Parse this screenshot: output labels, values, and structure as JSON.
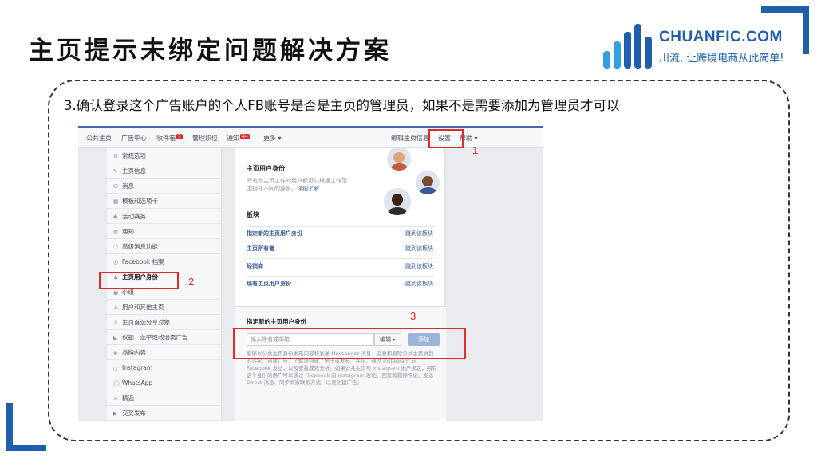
{
  "slide": {
    "title": "主页提示未绑定问题解决方案",
    "instruction": "3.确认登录这个广告账户的个人FB账号是否是主页的管理员，如果不是需要添加为管理员才可以"
  },
  "logo": {
    "name": "CHUANFIC.COM",
    "slogan": "川流, 让跨境电商从此简单!",
    "brand_color": "#1f5fae",
    "accent_color": "#2fa0e0"
  },
  "fb_nav": {
    "items": [
      "公共主页",
      "广告中心",
      "收件箱",
      "管理职位",
      "通知",
      "更多 ▾"
    ],
    "inbox_badge": "7",
    "notify_badge": "44",
    "right_items": [
      "编辑主页信息",
      "设置",
      "帮助 ▾"
    ]
  },
  "sidebar": {
    "items": [
      {
        "icon": "gear-icon",
        "glyph": "⚙",
        "label": "常规选项"
      },
      {
        "icon": "pencil-icon",
        "glyph": "✎",
        "label": "主页信息"
      },
      {
        "icon": "message-icon",
        "glyph": "✉",
        "label": "消息"
      },
      {
        "icon": "grid-icon",
        "glyph": "▦",
        "label": "模板和选项卡"
      },
      {
        "icon": "tag-icon",
        "glyph": "◆",
        "label": "活动赛务"
      },
      {
        "icon": "globe-icon",
        "glyph": "◍",
        "label": "通知"
      },
      {
        "icon": "chat-icon",
        "glyph": "◌",
        "label": "高级消息功能"
      },
      {
        "icon": "facebook-icon",
        "glyph": "◎",
        "label": "Facebook 档案"
      },
      {
        "icon": "person-icon",
        "glyph": "♟",
        "label": "主页用户身份"
      },
      {
        "icon": "group-icon",
        "glyph": "◒",
        "label": "小组"
      },
      {
        "icon": "people-icon",
        "glyph": "♙",
        "label": "用户和其他主页"
      },
      {
        "icon": "share-icon",
        "glyph": "♙",
        "label": "主页首选分享对象"
      },
      {
        "icon": "megaphone-icon",
        "glyph": "◣",
        "label": "议题、选举或政治类广告"
      },
      {
        "icon": "branded-content-icon",
        "glyph": "◈",
        "label": "品牌内容"
      },
      {
        "icon": "instagram-icon",
        "glyph": "◻",
        "label": "Instagram"
      },
      {
        "icon": "whatsapp-icon",
        "glyph": "◯",
        "label": "WhatsApp"
      },
      {
        "icon": "star-icon",
        "glyph": "★",
        "label": "精选"
      },
      {
        "icon": "video-icon",
        "glyph": "▶",
        "label": "交叉发布"
      }
    ]
  },
  "main": {
    "roles_title": "主页用户身份",
    "roles_desc": "所有为主页工作的用户都可以根据工作范围担任不同的身份。",
    "roles_link": "详细了解",
    "section_label": "板块",
    "rows": [
      {
        "label": "指定新的主页用户身份",
        "link": "跳到该板块"
      },
      {
        "label": "主页所有者",
        "link": "跳到该板块"
      },
      {
        "label": "经销商",
        "link": "跳到该板块"
      },
      {
        "label": "现有主页用户身份",
        "link": "跳到该板块"
      }
    ],
    "assign_title": "指定新的主页用户身份",
    "input_placeholder": "输入姓名或邮箱",
    "edit_label": "编辑 ▸",
    "add_label": "添加",
    "assign_desc": "能够以公共主页身份发布内容和发送 Messenger 消息、回复和删除公共主页收到的评论、创建广告、了解谁创建了帖子或发布了评论、通过 Instagram 向 Facebook 发帖，以及查看成效分析。如果公共主页与 Instagram 帐户绑定，拥有这个身份的用户可以通过 Facebook 向 Instagram 发帖、回复和删除评论、发送 Direct 消息、同步商家联系方式，以及创建广告。"
  },
  "annotations": {
    "n1": "1",
    "n2": "2",
    "n3": "3",
    "highlight_color": "#e0292b"
  }
}
